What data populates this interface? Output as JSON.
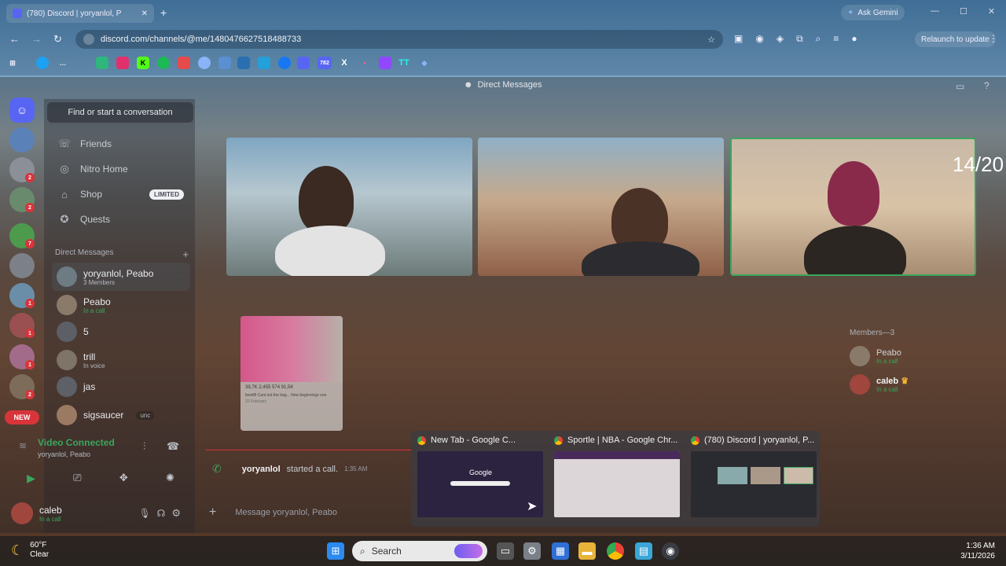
{
  "browser": {
    "tab_title": "(780) Discord | yoryanlol, P",
    "favicon_count": "780",
    "ask_gemini": "Ask Gemini",
    "url": "discord.com/channels/@me/1480476627518488733",
    "relaunch": "Relaunch to update",
    "bookmark_badge": "782"
  },
  "discord": {
    "header_title": "Direct Messages",
    "search_placeholder": "Find or start a conversation",
    "nav": [
      {
        "label": "Friends"
      },
      {
        "label": "Nitro Home"
      },
      {
        "label": "Shop",
        "badge": "LIMITED"
      },
      {
        "label": "Quests"
      }
    ],
    "dm_header": "Direct Messages",
    "dms": [
      {
        "name": "yoryanlol, Peabo",
        "sub": "3 Members"
      },
      {
        "name": "Peabo",
        "sub": "In a call"
      },
      {
        "name": "5",
        "sub": ""
      },
      {
        "name": "trill",
        "sub": "In voice"
      },
      {
        "name": "jas",
        "sub": ""
      },
      {
        "name": "sigsaucer",
        "sub": "unc"
      }
    ],
    "server_badges": [
      "2",
      "2",
      "7",
      "1",
      "1",
      "1",
      "2"
    ],
    "new_label": "NEW",
    "voice": {
      "status": "Video Connected",
      "channel": "yoryanlol, Peabo"
    },
    "user": {
      "name": "caleb",
      "status": "In a call"
    },
    "counter": "14/20",
    "post_stats": "39,7K  2,455  574  91,5K",
    "post_caption": "bestlifi Cant out the bag... New beginnings one",
    "post_date": "20 February",
    "members_header": "Members—3",
    "members": [
      {
        "name": "Peabo",
        "sub": "In a call"
      },
      {
        "name": "caleb",
        "sub": "In a call"
      }
    ],
    "call_user": "yoryanlol",
    "call_text": "started a call.",
    "call_time": "1:35 AM",
    "message_placeholder": "Message yoryanlol, Peabo"
  },
  "thumbnails": [
    {
      "title": "New Tab - Google C...",
      "page_text": "Google"
    },
    {
      "title": "Sportle | NBA - Google Chr..."
    },
    {
      "title": "(780) Discord | yoryanlol, P..."
    }
  ],
  "taskbar": {
    "weather_temp": "60°F",
    "weather_desc": "Clear",
    "search_label": "Search",
    "time": "1:36 AM",
    "date": "3/11/2026"
  },
  "colors": {
    "discord": "#5865f2",
    "green": "#3ba55c",
    "red": "#d8343a"
  }
}
